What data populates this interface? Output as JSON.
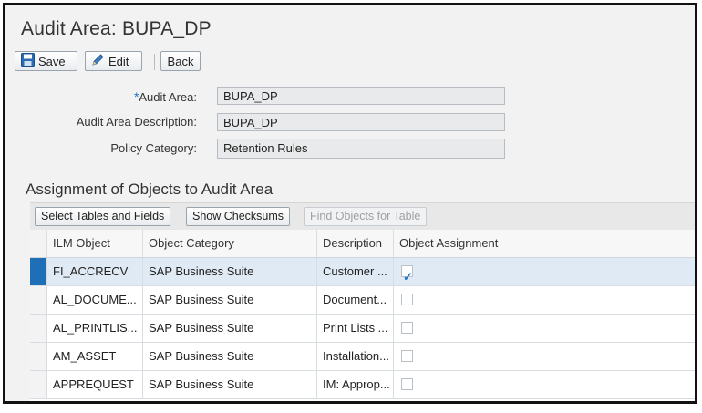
{
  "page": {
    "title": "Audit Area: BUPA_DP"
  },
  "toolbar": {
    "save_label": "Save",
    "edit_label": "Edit",
    "back_label": "Back"
  },
  "form": {
    "audit_area": {
      "label": "Audit Area:",
      "value": "BUPA_DP",
      "required": true
    },
    "audit_area_description": {
      "label": "Audit Area Description:",
      "value": "BUPA_DP"
    },
    "policy_category": {
      "label": "Policy Category:",
      "value": "Retention Rules"
    }
  },
  "assignment": {
    "title": "Assignment of Objects to Audit Area",
    "buttons": {
      "select_tables": "Select Tables and Fields",
      "show_checksums": "Show Checksums",
      "find_objects": "Find Objects for Table"
    },
    "columns": [
      "ILM Object",
      "Object Category",
      "Description",
      "Object Assignment"
    ],
    "rows": [
      {
        "ilm_object": "FI_ACCRECV",
        "category": "SAP Business Suite",
        "description": "Customer ...",
        "assigned": true,
        "selected": true
      },
      {
        "ilm_object": "AL_DOCUME...",
        "category": "SAP Business Suite",
        "description": "Document...",
        "assigned": false,
        "selected": false
      },
      {
        "ilm_object": "AL_PRINTLIS...",
        "category": "SAP Business Suite",
        "description": "Print Lists ...",
        "assigned": false,
        "selected": false
      },
      {
        "ilm_object": "AM_ASSET",
        "category": "SAP Business Suite",
        "description": "Installation...",
        "assigned": false,
        "selected": false
      },
      {
        "ilm_object": "APPREQUEST",
        "category": "SAP Business Suite",
        "description": "IM: Approp...",
        "assigned": false,
        "selected": false
      }
    ]
  },
  "colors": {
    "accent": "#1f6fb6",
    "selected_row": "#dfeaf5",
    "check": "#1d74c9"
  }
}
